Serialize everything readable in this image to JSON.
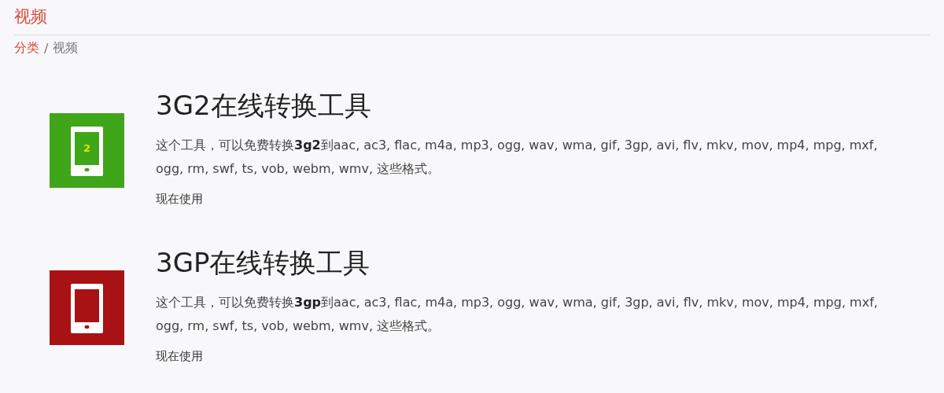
{
  "header": {
    "title": "视频"
  },
  "breadcrumb": {
    "separator": "/",
    "items": [
      {
        "label": "分类",
        "link": true
      },
      {
        "label": "视频",
        "link": false
      }
    ]
  },
  "tools": [
    {
      "title": "3G2在线转换工具",
      "description": "这个工具，可以免费转换**3g2**到aac, ac3, flac, m4a, mp3, ogg, wav, wma, gif, 3gp, avi, flv, mkv, mov, mp4, mpg, mxf, ogg, rm, swf, ts, vob, webm, wmv, 这些格式。",
      "action": "现在使用",
      "color": "#3fa61a",
      "icon_text": "2"
    },
    {
      "title": "3GP在线转换工具",
      "description": "这个工具，可以免费转换**3gp**到aac, ac3, flac, m4a, mp3, ogg, wav, wma, gif, 3gp, avi, flv, mkv, mov, mp4, mpg, mxf, ogg, rm, swf, ts, vob, webm, wmv, 这些格式。",
      "action": "现在使用",
      "color": "#a81214"
    }
  ]
}
